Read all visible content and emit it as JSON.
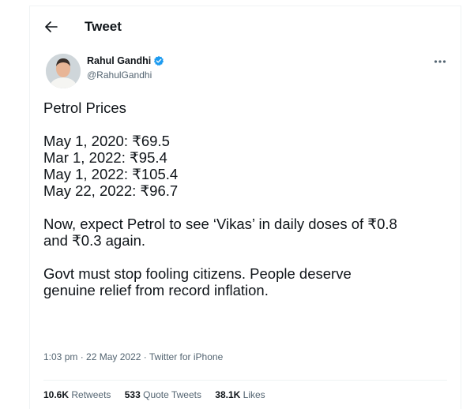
{
  "header": {
    "title": "Tweet"
  },
  "author": {
    "name": "Rahul Gandhi",
    "handle": "@RahulGandhi",
    "verified_color": "#1d9bf0"
  },
  "tweet": {
    "lines": [
      "Petrol Prices",
      "",
      "May 1, 2020: ₹69.5",
      "Mar 1, 2022: ₹95.4",
      "May 1, 2022: ₹105.4",
      "May 22, 2022: ₹96.7",
      "",
      "Now, expect Petrol to see ‘Vikas’ in daily doses of ₹0.8",
      "and ₹0.3 again.",
      "",
      "Govt must stop fooling citizens. People deserve",
      "genuine relief from record inflation."
    ]
  },
  "meta": {
    "time": "1:03 pm",
    "sep1": " · ",
    "date": "22 May 2022",
    "sep2": " · ",
    "source": "Twitter for iPhone"
  },
  "stats": [
    {
      "count": "10.6K",
      "label": "Retweets"
    },
    {
      "count": "533",
      "label": "Quote Tweets"
    },
    {
      "count": "38.1K",
      "label": "Likes"
    }
  ],
  "colors": {
    "text": "#0f1419",
    "secondary": "#536471",
    "accent": "#1d9bf0",
    "border": "#eff3f4"
  },
  "icons": {
    "back": "arrow-left-icon",
    "verified": "verified-badge-icon",
    "more": "more-horizontal-icon"
  }
}
